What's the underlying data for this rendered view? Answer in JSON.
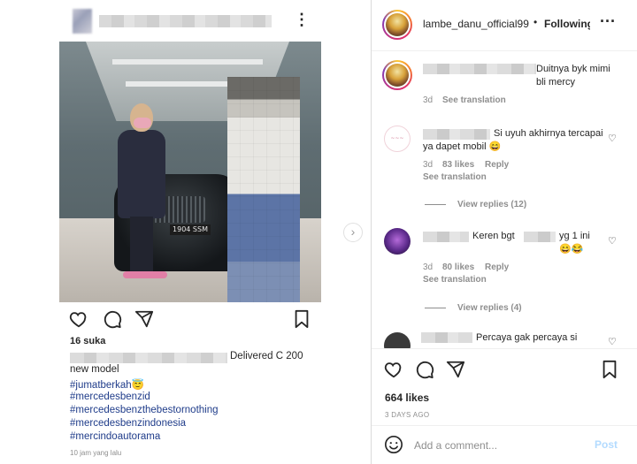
{
  "left_post": {
    "likes": "16 suka",
    "caption_tail": "Delivered C 200",
    "caption_lines": [
      "new model",
      "#jumatberkah😇",
      "#mercedesbenzid",
      "#mercedesbenzthebestornothing",
      "#mercedesbenzindonesia",
      "#mercindoautorama"
    ],
    "time": "10 jam yang lalu",
    "plate_text": "1904 SSM"
  },
  "right_pane": {
    "username": "lambe_danu_official99",
    "dot": "•",
    "follow_label": "Following",
    "more_icon": "more-horizontal-icon",
    "comments": [
      {
        "text": "Duitnya byk mimi bli mercy",
        "time": "3d",
        "likes": "",
        "reply": "",
        "translation": "See translation"
      },
      {
        "text": "Si uyuh akhirnya tercapai ya dapet mobil 😄",
        "time": "3d",
        "likes": "83 likes",
        "reply": "Reply",
        "translation": "See translation",
        "view_replies": "View replies (12)"
      },
      {
        "text": "Keren bgt",
        "text2": "yg 1 ini 😄😂",
        "time": "3d",
        "likes": "80 likes",
        "reply": "Reply",
        "translation": "See translation",
        "view_replies": "View replies (4)"
      },
      {
        "text": "Percaya gak percaya si"
      }
    ],
    "likes_total": "664 likes",
    "date": "3 DAYS AGO",
    "add_comment_placeholder": "Add a comment...",
    "post_label": "Post"
  },
  "colors": {
    "hashtag": "#1f3c8a",
    "post_button": "#b3dbff",
    "muted": "#8e8e8e"
  }
}
